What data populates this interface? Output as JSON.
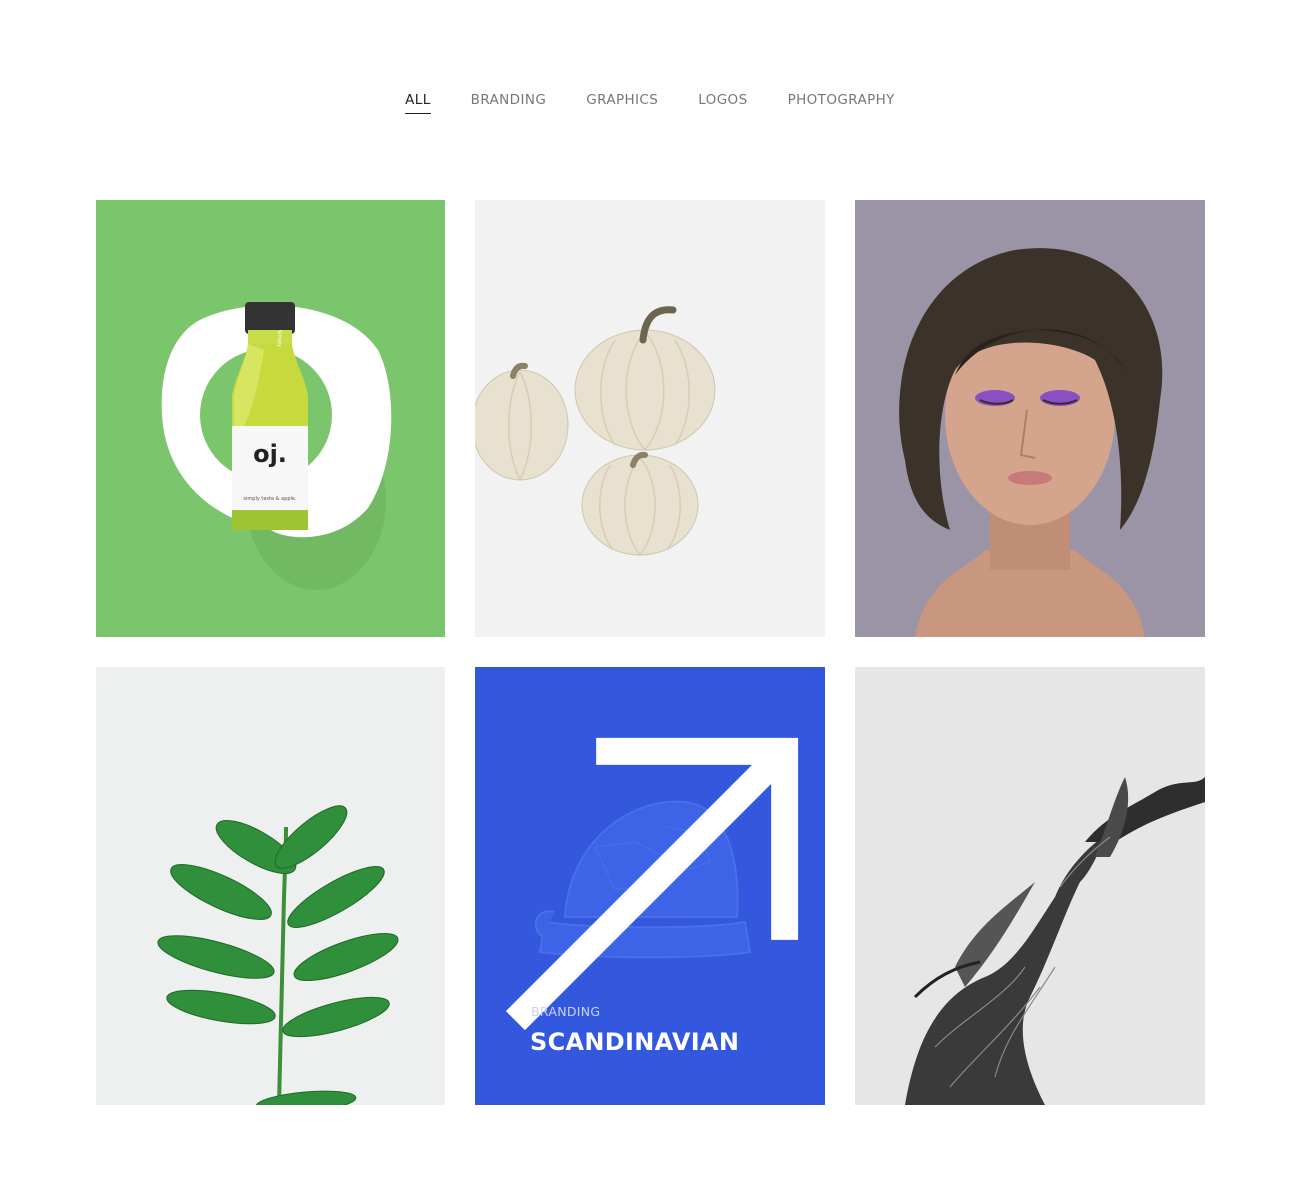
{
  "filters": [
    {
      "label": "ALL",
      "active": true
    },
    {
      "label": "BRANDING",
      "active": false
    },
    {
      "label": "GRAPHICS",
      "active": false
    },
    {
      "label": "LOGOS",
      "active": false
    },
    {
      "label": "PHOTOGRAPHY",
      "active": false
    }
  ],
  "bottle": {
    "label": "oj.",
    "tagline": "simply taste & apple.",
    "brand": "Simply"
  },
  "portfolio": [
    {
      "image": "juice-bottle-mockup",
      "color": "#7bc56c"
    },
    {
      "image": "white-pumpkins"
    },
    {
      "image": "portrait-purple-eyeshadow",
      "color": "#9b93a6"
    },
    {
      "image": "green-plant"
    },
    {
      "image": "tortoise-figurine",
      "category": "BRANDING",
      "title": "SCANDINAVIAN",
      "color": "#3358dd",
      "hovered": true
    },
    {
      "image": "driftwood-branch"
    }
  ]
}
